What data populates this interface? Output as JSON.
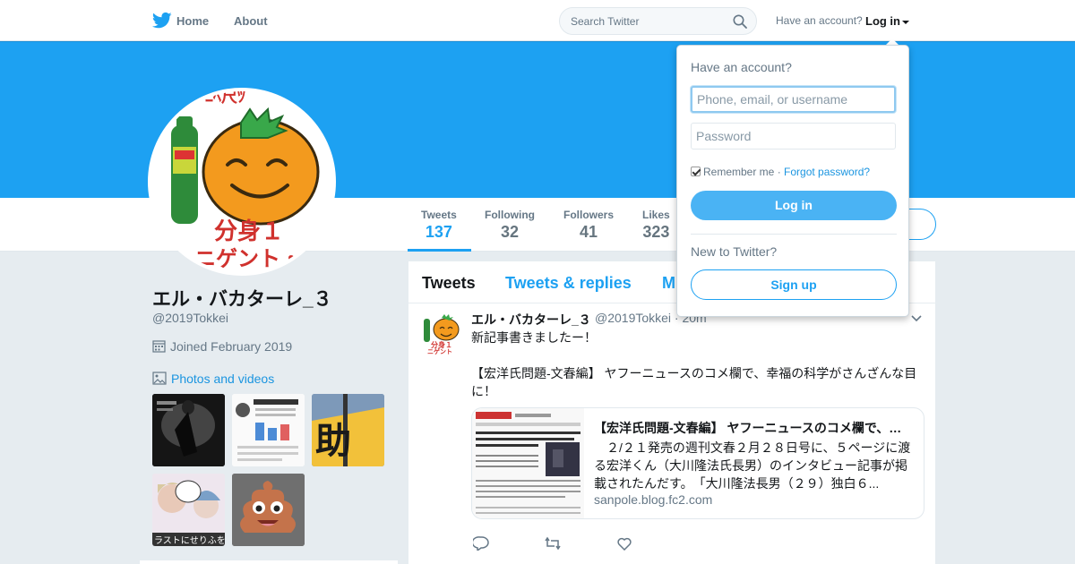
{
  "nav": {
    "home": "Home",
    "about": "About",
    "search_placeholder": "Search Twitter",
    "have_account": "Have an account?",
    "login": "Log in"
  },
  "profile": {
    "name": "エル・バカターレ_３",
    "handle": "@2019Tokkei",
    "joined": "Joined February 2019",
    "photos_link": "Photos and videos",
    "avatar_text_1": "分身１",
    "avatar_text_2": "ニゲント・"
  },
  "stats": [
    {
      "label": "Tweets",
      "value": "137"
    },
    {
      "label": "Following",
      "value": "32"
    },
    {
      "label": "Followers",
      "value": "41"
    },
    {
      "label": "Likes",
      "value": "323"
    }
  ],
  "thumbnails": {
    "thumb3_text": "助"
  },
  "timeline": {
    "tabs": [
      "Tweets",
      "Tweets & replies",
      "M"
    ],
    "tweet": {
      "name": "エル・バカターレ_３",
      "handle": "@2019Tokkei · 20m",
      "text1": "新記事書きましたー！",
      "text2": "【宏洋氏問題-文春編】 ヤフーニュースのコメ欄で、幸福の科学がさんざんな目に！",
      "card": {
        "title": "【宏洋氏問題-文春編】 ヤフーニュースのコメ欄で、幸福の科学がさんざんな目に！",
        "description": "　２/２１発売の週刊文春２月２８日号に、５ページに渡る宏洋くん（大川隆法氏長男）のインタビュー記事が掲載されたんだす。　「大川隆法長男（２９）独白６...",
        "url": "sanpole.blog.fc2.com"
      }
    }
  },
  "login_dropdown": {
    "title": "Have an account?",
    "username_placeholder": "Phone, email, or username",
    "password_placeholder": "Password",
    "remember": "Remember me",
    "separator": " · ",
    "forgot": "Forgot password?",
    "login_button": "Log in",
    "new_to_twitter": "New to Twitter?",
    "signup_button": "Sign up"
  },
  "colors": {
    "accent": "#1da1f2",
    "banner": "#1da1f2",
    "background": "#e6ecf0"
  }
}
